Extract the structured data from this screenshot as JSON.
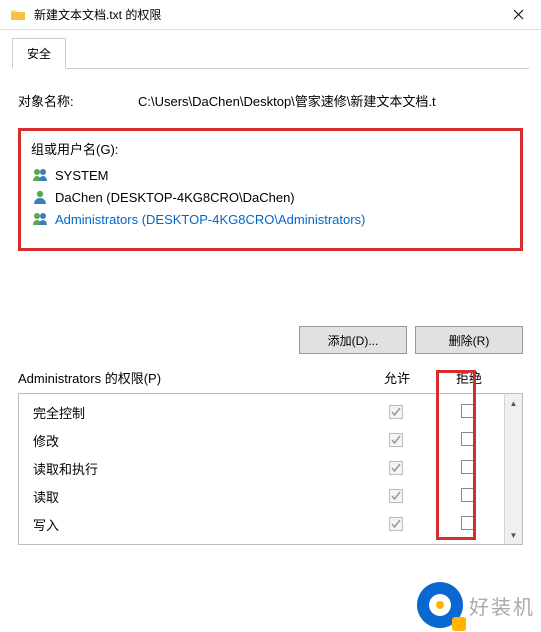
{
  "window": {
    "title": "新建文本文档.txt 的权限",
    "close": "×"
  },
  "tab": {
    "security": "安全"
  },
  "object": {
    "label": "对象名称:",
    "value": "C:\\Users\\DaChen\\Desktop\\管家速修\\新建文本文档.t"
  },
  "group": {
    "label": "组或用户名(G):",
    "users": [
      {
        "name": "SYSTEM",
        "type": "group"
      },
      {
        "name": "DaChen (DESKTOP-4KG8CRO\\DaChen)",
        "type": "user"
      },
      {
        "name": "Administrators (DESKTOP-4KG8CRO\\Administrators)",
        "type": "group",
        "selected": true
      }
    ]
  },
  "buttons": {
    "add": "添加(D)...",
    "remove": "删除(R)"
  },
  "perm": {
    "header_label": "Administrators 的权限(P)",
    "col_allow": "允许",
    "col_deny": "拒绝",
    "rows": [
      {
        "name": "完全控制",
        "allow": true,
        "deny": false
      },
      {
        "name": "修改",
        "allow": true,
        "deny": false
      },
      {
        "name": "读取和执行",
        "allow": true,
        "deny": false
      },
      {
        "name": "读取",
        "allow": true,
        "deny": false
      },
      {
        "name": "写入",
        "allow": true,
        "deny": false
      }
    ]
  },
  "watermark": {
    "text": "好装机"
  }
}
